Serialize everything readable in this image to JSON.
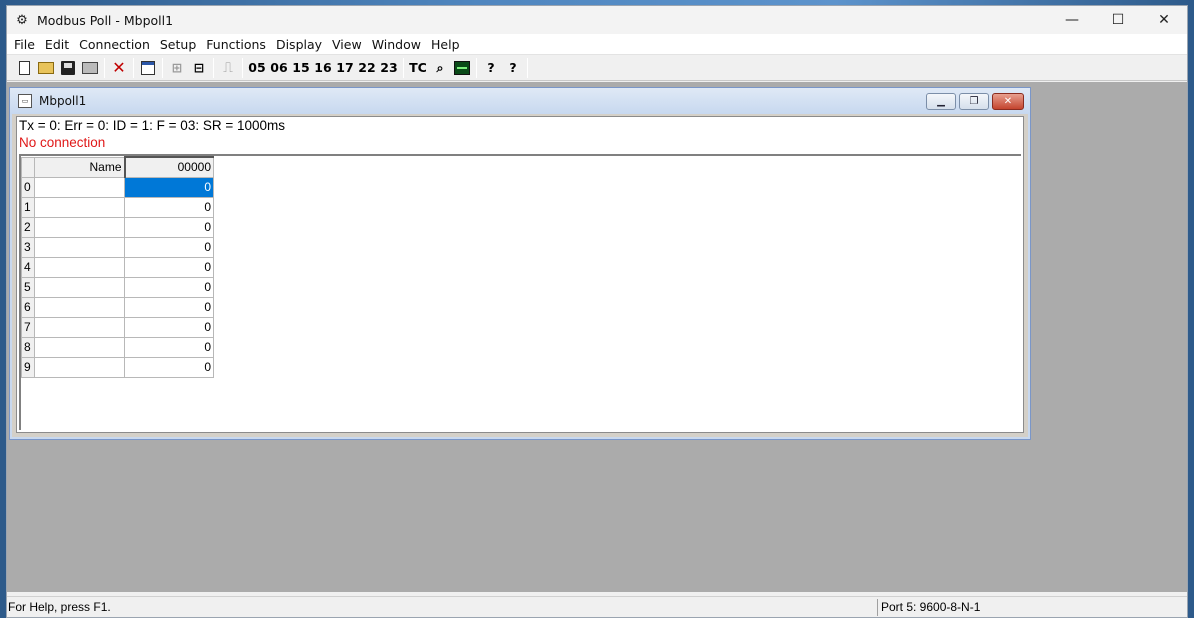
{
  "app": {
    "title": "Modbus Poll - Mbpoll1",
    "icon": "modbus-app-icon"
  },
  "window_controls": {
    "minimize": "—",
    "maximize": "☐",
    "close": "✕"
  },
  "menu": [
    "File",
    "Edit",
    "Connection",
    "Setup",
    "Functions",
    "Display",
    "View",
    "Window",
    "Help"
  ],
  "toolbar": {
    "function_codes": [
      "05",
      "06",
      "15",
      "16",
      "17",
      "22",
      "23"
    ],
    "tc_label": "TC",
    "help_glyph": "?",
    "context_help_glyph": "?"
  },
  "child": {
    "title": "Mbpoll1",
    "status": "Tx = 0: Err = 0: ID = 1: F = 03: SR = 1000ms",
    "connection": "No connection",
    "grid": {
      "col_name": "Name",
      "col_value": "00000",
      "rows": [
        {
          "index": "0",
          "name": "",
          "value": "0"
        },
        {
          "index": "1",
          "name": "",
          "value": "0"
        },
        {
          "index": "2",
          "name": "",
          "value": "0"
        },
        {
          "index": "3",
          "name": "",
          "value": "0"
        },
        {
          "index": "4",
          "name": "",
          "value": "0"
        },
        {
          "index": "5",
          "name": "",
          "value": "0"
        },
        {
          "index": "6",
          "name": "",
          "value": "0"
        },
        {
          "index": "7",
          "name": "",
          "value": "0"
        },
        {
          "index": "8",
          "name": "",
          "value": "0"
        },
        {
          "index": "9",
          "name": "",
          "value": "0"
        }
      ]
    }
  },
  "statusbar": {
    "help": "For Help, press F1.",
    "port": "Port 5: 9600-8-N-1"
  },
  "colors": {
    "selection": "#0078d7",
    "no_connection": "#e01818"
  }
}
